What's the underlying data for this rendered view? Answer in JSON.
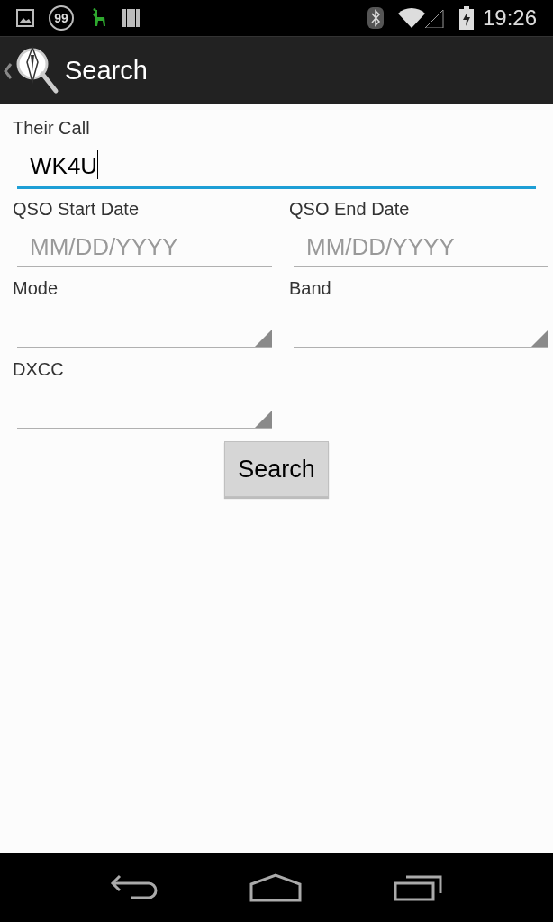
{
  "status_bar": {
    "notification_count": "99",
    "time": "19:26"
  },
  "action_bar": {
    "title": "Search"
  },
  "their_call": {
    "label": "Their Call",
    "value": "WK4U",
    "focused": true
  },
  "dates": [
    {
      "label": "QSO Start Date",
      "placeholder": "MM/DD/YYYY"
    },
    {
      "label": "QSO End Date",
      "placeholder": "MM/DD/YYYY"
    }
  ],
  "spinners_row": [
    {
      "label": "Mode"
    },
    {
      "label": "Band"
    }
  ],
  "dxcc": {
    "label": "DXCC"
  },
  "search_button": "Search"
}
